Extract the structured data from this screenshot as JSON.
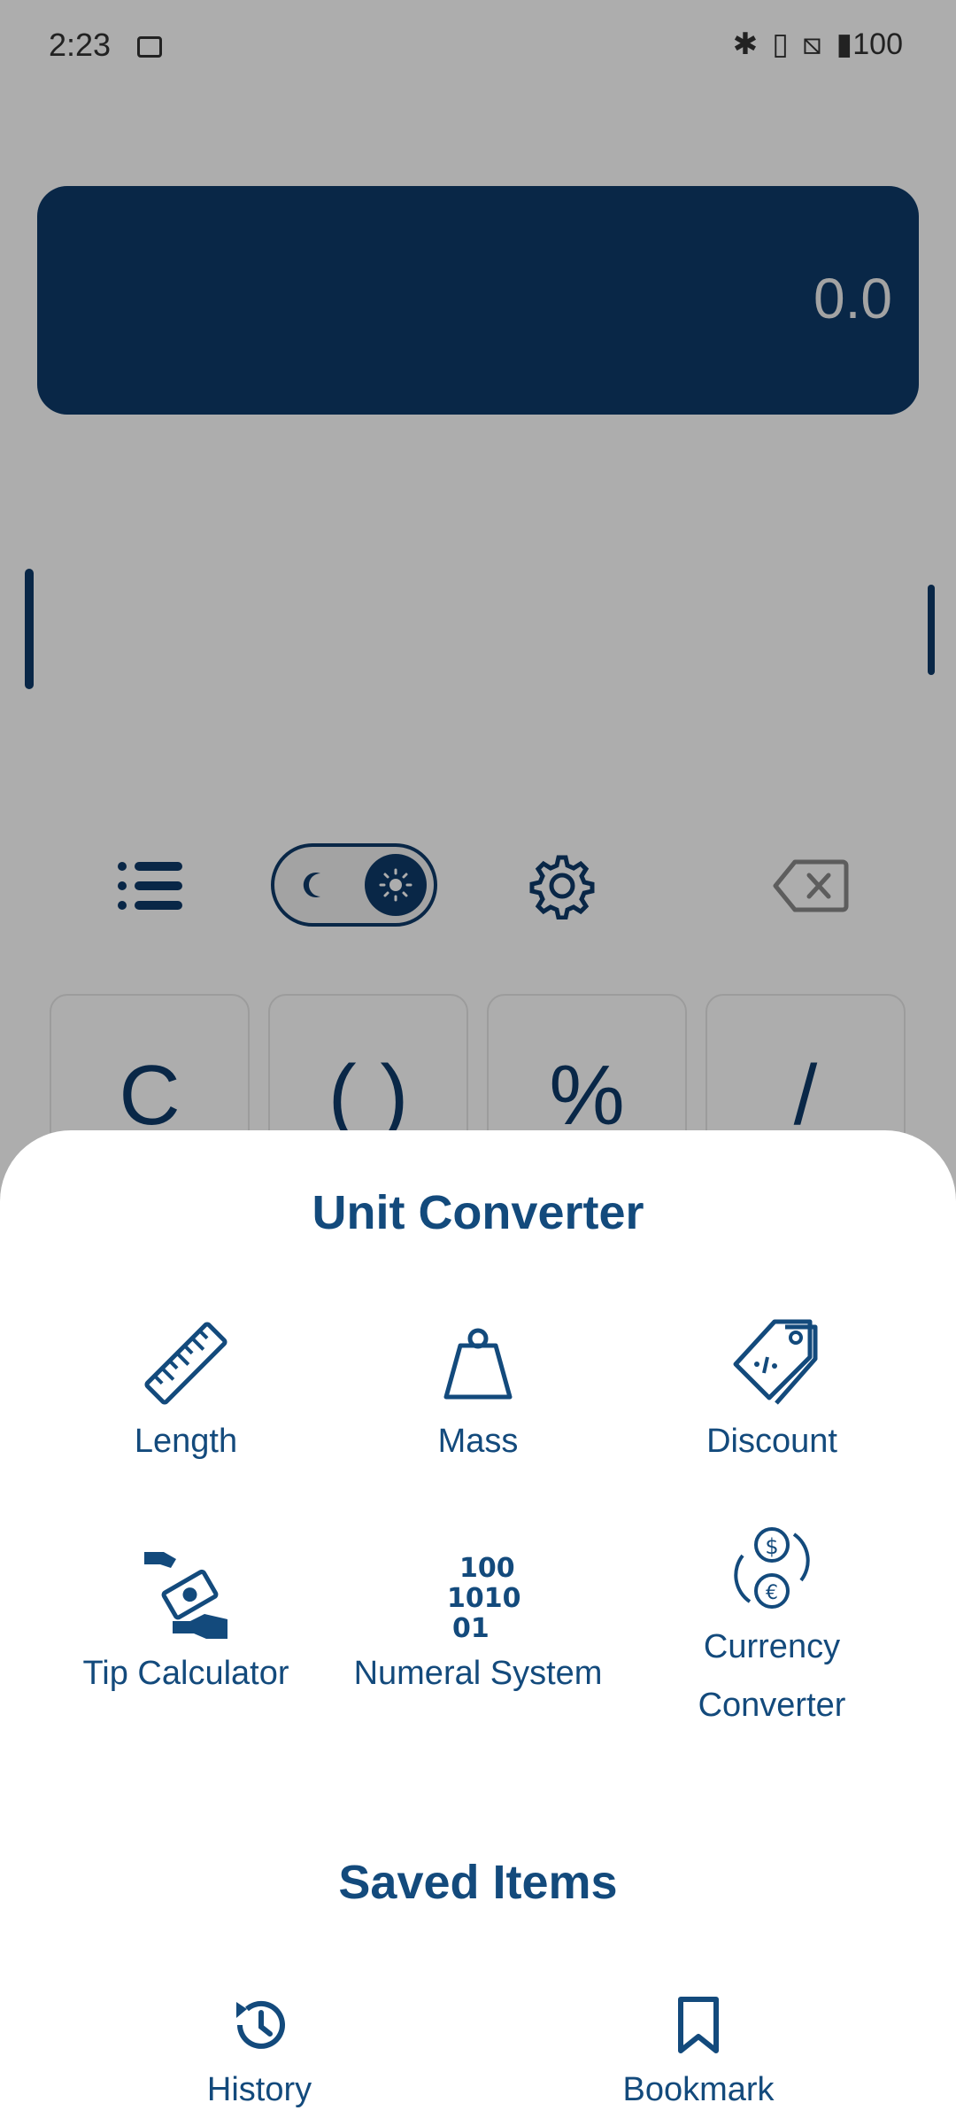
{
  "status_bar": {
    "time": "2:23",
    "battery": "100"
  },
  "display": {
    "value": "0.0"
  },
  "keys": [
    "C",
    "( )",
    "%",
    "/"
  ],
  "sheet": {
    "converter_title": "Unit Converter",
    "items": [
      {
        "label": "Length",
        "icon": "ruler-icon"
      },
      {
        "label": "Mass",
        "icon": "weight-icon"
      },
      {
        "label": "Discount",
        "icon": "price-tag-icon"
      },
      {
        "label": "Tip Calculator",
        "icon": "money-hand-icon"
      },
      {
        "label": "Numeral System",
        "icon": "binary-icon"
      },
      {
        "label": "Currency Converter",
        "icon": "currency-exchange-icon"
      }
    ],
    "saved_title": "Saved Items",
    "saved": [
      {
        "label": "History",
        "icon": "history-icon"
      },
      {
        "label": "Bookmark",
        "icon": "bookmark-icon"
      }
    ]
  },
  "colors": {
    "primary": "#134a7c",
    "display_bg": "#0e3a69"
  }
}
